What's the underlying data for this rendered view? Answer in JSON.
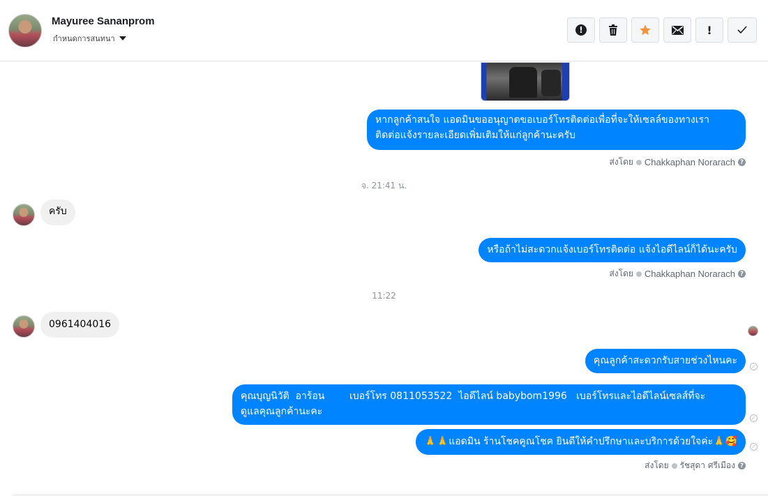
{
  "header": {
    "contact_name": "Mayuree Sananprom",
    "assign_label": "กำหนดการสนทนา",
    "toolbar": [
      {
        "name": "report-button",
        "icon": "alert-circle-icon",
        "glyph": "!"
      },
      {
        "name": "delete-button",
        "icon": "trash-icon",
        "glyph": "🗑"
      },
      {
        "name": "star-button",
        "icon": "star-icon",
        "glyph": "★",
        "color": "#f7923a"
      },
      {
        "name": "mail-button",
        "icon": "envelope-icon",
        "glyph": "✉"
      },
      {
        "name": "important-button",
        "icon": "exclamation-icon",
        "glyph": "!"
      },
      {
        "name": "done-button",
        "icon": "checkmark-icon",
        "glyph": "✓"
      }
    ]
  },
  "colors": {
    "outgoing_bubble": "#0084ff",
    "incoming_bubble": "#f1f0f0",
    "star": "#f7923a"
  },
  "messages": {
    "m1": "หากลูกค้าสนใจ แอดมินขออนุญาตขอเบอร์โทรติดต่อเพื่อที่จะให้เซลล์ของทางเรา\nติดต่อแจ้งรายละเอียดเพิ่มเติมให้แก่ลูกค้านะครับ",
    "m1_sentby_prefix": "ส่งโดย",
    "m1_sentby_name": "Chakkaphan Norarach",
    "ts1": "จ. 21:41 น.",
    "m2": "ครับ",
    "m3": "หรือถ้าไม่สะดวกแจ้งเบอร์โทรติดต่อ แจ้งไอดีไลน์ก็ได้นะครับ",
    "m3_sentby_prefix": "ส่งโดย",
    "m3_sentby_name": "Chakkaphan Norarach",
    "ts2": "11:22",
    "m4": "0961404016",
    "m5": "คุณลูกค้าสะดวกรับสายช่วงไหนคะ",
    "m6": "คุณบุญนิวัติ  อาร้อน        เบอร์โทร 0811053522  ไอดีไลน์ babybom1996   เบอร์โทรและไอดีไลน์เซลส์ที่จะ\nดูแลคุณลูกค้านะคะ",
    "m7": "🙏🙏แอดมิน ร้านโชคคูณโชค ยินดีให้คำปรึกษาและบริการด้วยใจค่ะ🙏🥰",
    "m7_sentby_prefix": "ส่งโดย",
    "m7_sentby_name": "รัชสุดา ศรีเมือง"
  }
}
